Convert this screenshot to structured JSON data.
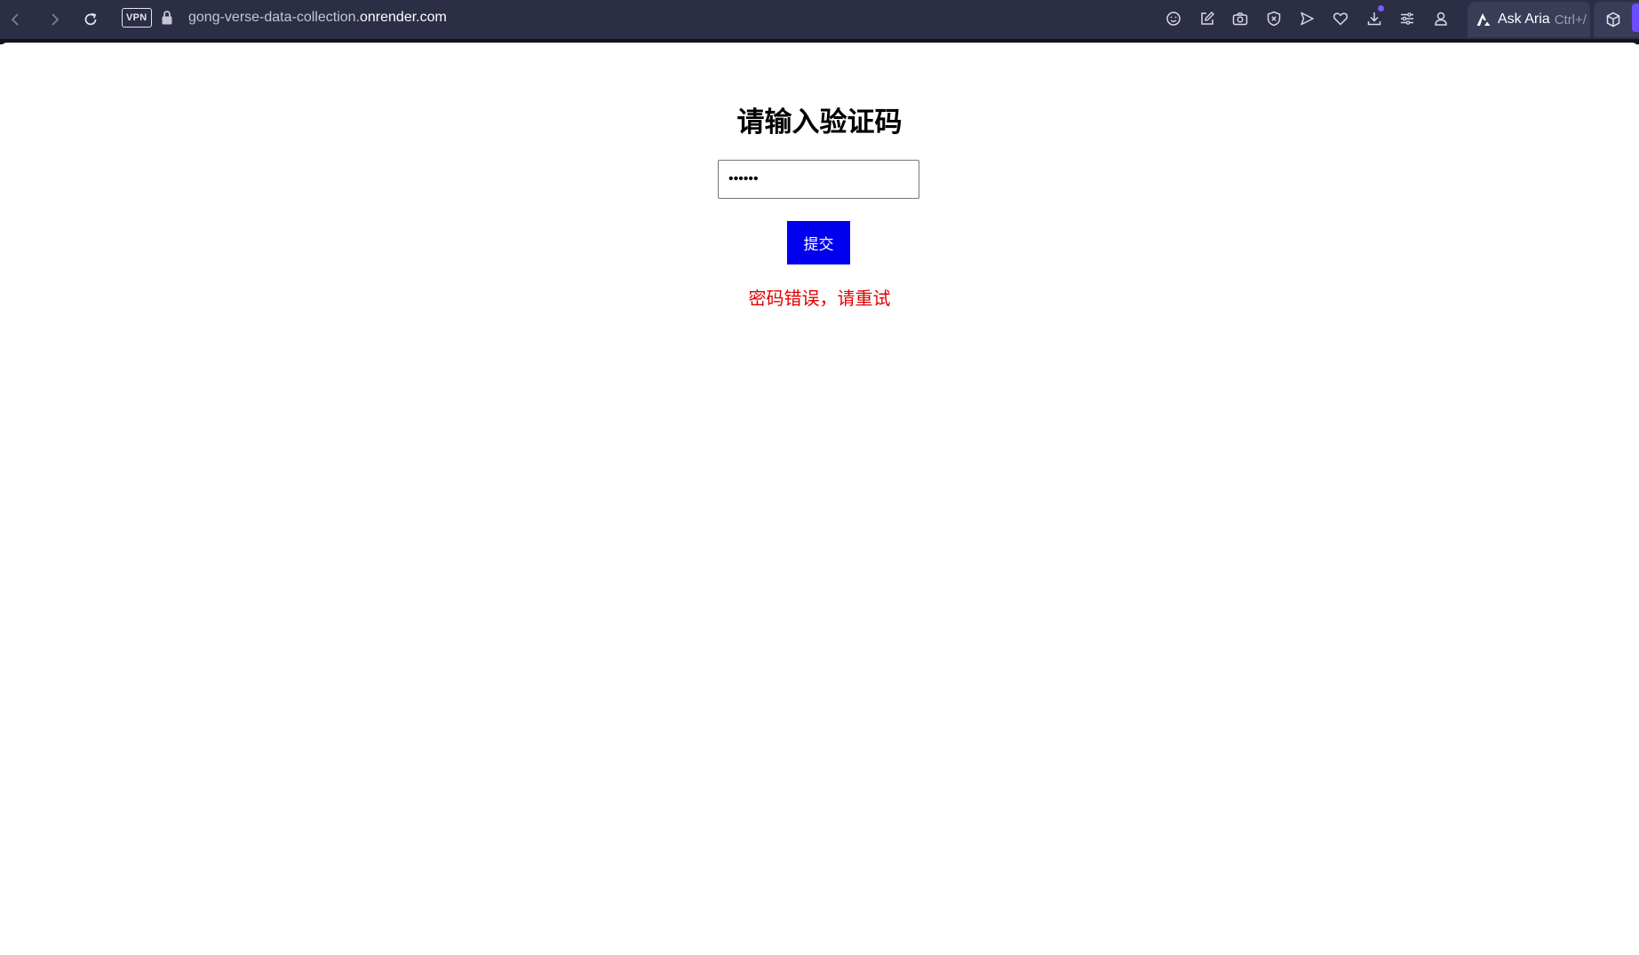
{
  "browser": {
    "vpn_label": "VPN",
    "url_prefix": "gong-verse-data-collection.",
    "url_domain": "onrender.com",
    "aria_label": "Ask Aria",
    "aria_shortcut": "Ctrl+/",
    "toolbar_icons": [
      "smiley-icon",
      "edit-icon",
      "camera-icon",
      "shield-icon",
      "send-icon",
      "heart-icon",
      "download-icon",
      "menu-icon",
      "profile-icon"
    ],
    "accent_color": "#6b4cff"
  },
  "page": {
    "title": "请输入验证码",
    "input_value": "123456",
    "submit_label": "提交",
    "error_message": "密码错误，请重试",
    "submit_color": "#0000ee",
    "error_color": "#e00000"
  }
}
